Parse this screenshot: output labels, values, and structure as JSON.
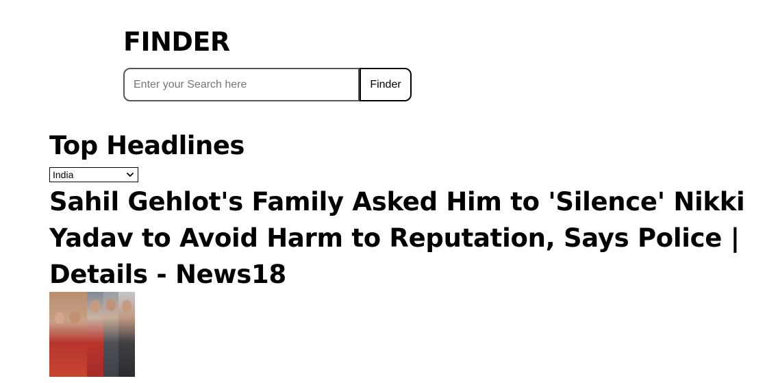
{
  "header": {
    "title": "FINDER"
  },
  "search": {
    "placeholder": "Enter your Search here",
    "value": "",
    "button_label": "Finder"
  },
  "section": {
    "title": "Top Headlines",
    "country_select": {
      "selected": "India"
    }
  },
  "articles": [
    {
      "title": "Sahil Gehlot's Family Asked Him to 'Silence' Nikki Yadav to Avoid Harm to Reputation, Says Police | Details - News18"
    }
  ]
}
